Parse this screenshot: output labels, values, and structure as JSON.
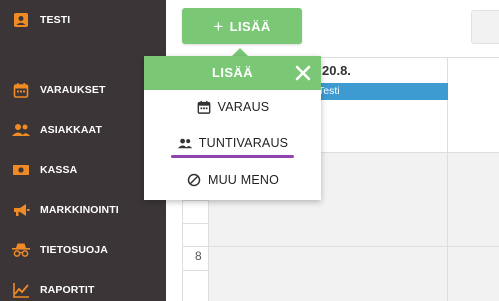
{
  "sidebar": {
    "bg_color": "#3b3538",
    "accent_color": "#f08a24",
    "items": [
      {
        "label": "TESTI",
        "icon": "account-box-icon"
      },
      {
        "label": "VARAUKSET",
        "icon": "calendar-icon"
      },
      {
        "label": "ASIAKKAAT",
        "icon": "people-icon"
      },
      {
        "label": "KASSA",
        "icon": "cash-icon"
      },
      {
        "label": "MARKKINOINTI",
        "icon": "megaphone-icon"
      },
      {
        "label": "TIETOSUOJA",
        "icon": "incognito-icon"
      },
      {
        "label": "RAPORTIT",
        "icon": "chart-line-icon"
      }
    ]
  },
  "toolbar": {
    "add_button_label": "LISÄÄ",
    "add_button_color": "#7ac776"
  },
  "dropdown": {
    "title": "LISÄÄ",
    "items": [
      {
        "label": "VARAUS",
        "icon": "calendar-icon"
      },
      {
        "label": "TUNTIVARAUS",
        "icon": "people-icon"
      },
      {
        "label": "MUU MENO",
        "icon": "block-icon"
      }
    ],
    "underline_color": "#8e44ad"
  },
  "calendar": {
    "day_header": "20.8.",
    "event_label": "Testi",
    "event_color": "#3d9bd1",
    "hour_label": "8"
  }
}
